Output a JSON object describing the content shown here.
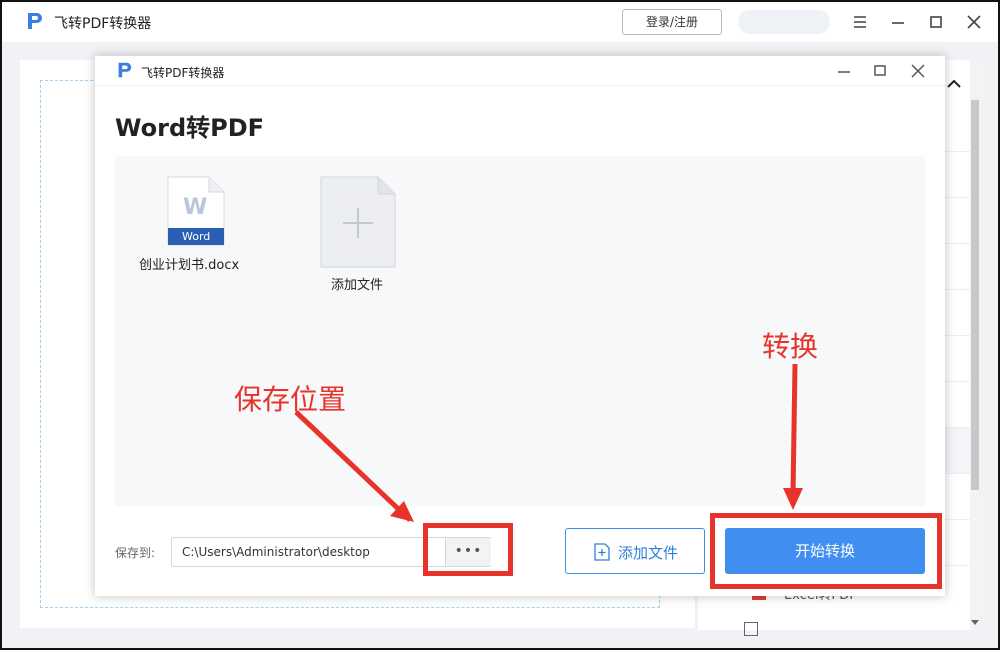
{
  "app": {
    "title": "飞转PDF转换器",
    "login_label": "登录/注册"
  },
  "dialog": {
    "title": "飞转PDF转换器",
    "heading": "Word转PDF",
    "files": [
      {
        "name": "创业计划书.docx",
        "badge": "Word",
        "letter": "W"
      }
    ],
    "add_tile_label": "添加文件",
    "save_to_label": "保存到:",
    "save_path": "C:\\Users\\Administrator\\desktop",
    "more_label": "•••",
    "add_file_button": "添加文件",
    "start_button": "开始转换"
  },
  "sidebar": {
    "partial_item": "Excel转PDF"
  },
  "annotations": {
    "save_location": "保存位置",
    "convert": "转换"
  },
  "colors": {
    "accent": "#3f8ef0",
    "annotation": "#e8332a",
    "word_blue": "#2b5fb4"
  }
}
